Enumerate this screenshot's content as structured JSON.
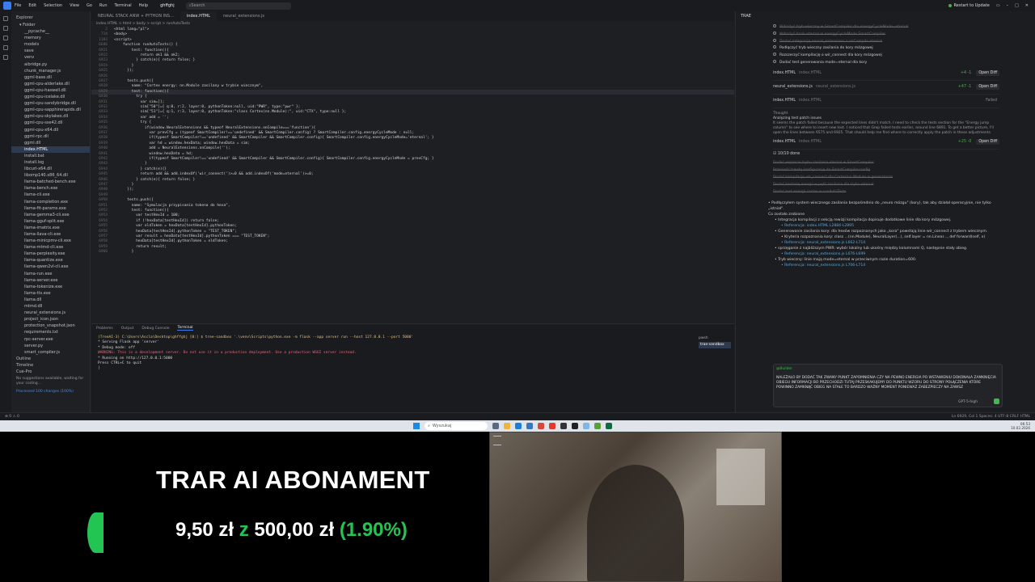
{
  "titlebar": {
    "menu": [
      "File",
      "Edit",
      "Selection",
      "View",
      "Go",
      "Run",
      "Terminal",
      "Help"
    ],
    "project": "ghffghj",
    "search_placeholder": "Search",
    "restart_label": "Restart to Update"
  },
  "explorer": {
    "header": "Explorer",
    "folder_label": "Folder",
    "items": [
      "__pycache__",
      "memory",
      "models",
      "save",
      "venv",
      "aibridge.py",
      "chunk_manager.js",
      "ggml-base.dll",
      "ggml-cpu-alderlake.dll",
      "ggml-cpu-haswell.dll",
      "ggml-cpu-icelake.dll",
      "ggml-cpu-sandybridge.dll",
      "ggml-cpu-sapphirerapids.dll",
      "ggml-cpu-skylakex.dll",
      "ggml-cpu-sse42.dll",
      "ggml-cpu-x64.dll",
      "ggml-rpc.dll",
      "ggml.dll",
      "index.HTML",
      "install.bat",
      "install.log",
      "libcurl-x64.dll",
      "libomp140.x86_64.dll",
      "llama-batched-bench.exe",
      "llama-bench.exe",
      "llama-cli.exe",
      "llama-completion.exe",
      "llama-fit-params.exe",
      "llama-gemma3-cli.exe",
      "llama-gguf-split.exe",
      "llama-imatrix.exe",
      "llama-llava-cli.exe",
      "llama-minicpmv-cli.exe",
      "llama-mtmd-cli.exe",
      "llama-perplexity.exe",
      "llama-quantize.exe",
      "llama-qwen2vl-cli.exe",
      "llama-run.exe",
      "llama-server.exe",
      "llama-tokenize.exe",
      "llama-tts.exe",
      "llama.dll",
      "mtmd.dll",
      "neural_extensions.js",
      "project_icon.json",
      "protection_snapshot.json",
      "requirements.txt",
      "rpc-server.exe",
      "server.py",
      "smart_compiler.js"
    ],
    "selected": "index.HTML",
    "sections": [
      "Outline",
      "Timeline",
      "Cue-Pro"
    ],
    "note": "No suggestions available, waiting for your coding...",
    "processed": "Processed 100 changes (100%)"
  },
  "editor": {
    "tabs": [
      "NEURAL STACK ANW + PYTHON INS...",
      "index.HTML",
      "neural_extensions.js"
    ],
    "active_tab": "index.HTML",
    "breadcrumb": "index.HTML > html > body > script > runAutoTests",
    "lines": [
      {
        "n": "2",
        "t": "<html lang=\"pl\">"
      },
      {
        "n": "714",
        "t": "<body>"
      },
      {
        "n": "1183",
        "t": "<script>"
      },
      {
        "n": "6686",
        "t": "    function runAutoTests() {"
      },
      {
        "n": "6921",
        "t": "        test: function(){"
      },
      {
        "n": "6922",
        "t": "            return ok1 && ok2;"
      },
      {
        "n": "6923",
        "t": "          } catch(e){ return false; }"
      },
      {
        "n": "6924",
        "t": "        }"
      },
      {
        "n": "6925",
        "t": "      });"
      },
      {
        "n": "6926",
        "t": ""
      },
      {
        "n": "6927",
        "t": "      tests.push({"
      },
      {
        "n": "6928",
        "t": "        name: \"Cortex energy: nn.Module zasilany w trybie wiecznym\","
      },
      {
        "n": "6929",
        "t": "        test: function(){"
      },
      {
        "n": "6930",
        "t": "          try {"
      },
      {
        "n": "6931",
        "t": "            var sim=[];"
      },
      {
        "n": "6932",
        "t": "            sim[\"50\"]={ q:0, r:2, layer:0, pythonToken:null, uid:\"PWR\", type:\"pwr\" };"
      },
      {
        "n": "6933",
        "t": "            sim[\"51\"]={ q:1, r:3, layer:0, pythonToken:\"class Cortex(nn.Module):\", uid:\"CTX\", type:null };"
      },
      {
        "n": "6934",
        "t": "            var add = '';"
      },
      {
        "n": "6935",
        "t": "            try {"
      },
      {
        "n": "6936",
        "t": "              if(window.NeuralExtensions && typeof NeuralExtensions.onCompile==='function'){"
      },
      {
        "n": "6937",
        "t": "                var prevCfg = (typeof SmartCompiler!=='undefined' && SmartCompiler.config) ? SmartCompiler.config.energyCycleMode : null;"
      },
      {
        "n": "6938",
        "t": "                if(typeof SmartCompiler!=='undefined' && SmartCompiler && SmartCompiler.config){ SmartCompiler.config.energyCycleMode='eternal'; }"
      },
      {
        "n": "6939",
        "t": "                var hd = window.hexData; window.hexData = sim;"
      },
      {
        "n": "6940",
        "t": "                add = NeuralExtensions.onCompile('');"
      },
      {
        "n": "6941",
        "t": "                window.hexData = hd;"
      },
      {
        "n": "6942",
        "t": "                if(typeof SmartCompiler!=='undefined' && SmartCompiler && SmartCompiler.config){ SmartCompiler.config.energyCycleMode = prevCfg; }"
      },
      {
        "n": "6943",
        "t": "              }"
      },
      {
        "n": "6944",
        "t": "            } catch(e){}"
      },
      {
        "n": "6945",
        "t": "            return add && add.indexOf('wir_connect(')>=0 && add.indexOf('mode=eternal')>=0;"
      },
      {
        "n": "6946",
        "t": "          } catch(e){ return false; }"
      },
      {
        "n": "6947",
        "t": "        }"
      },
      {
        "n": "6948",
        "t": "      });"
      },
      {
        "n": "6949",
        "t": ""
      },
      {
        "n": "6950",
        "t": "      tests.push({"
      },
      {
        "n": "6951",
        "t": "        name: \"Symulacja przypisania tokena do hexa\","
      },
      {
        "n": "6952",
        "t": "        test: function(){"
      },
      {
        "n": "6953",
        "t": "          var testHexId = 100;"
      },
      {
        "n": "6954",
        "t": "          if (!hexData[testHexId]) return false;"
      },
      {
        "n": "6955",
        "t": "          var oldToken = hexData[testHexId].pythonToken;"
      },
      {
        "n": "6956",
        "t": "          hexData[testHexId].pythonToken = \"TEST_TOKEN\";"
      },
      {
        "n": "6957",
        "t": "          var result = hexData[testHexId].pythonToken === \"TEST_TOKEN\";"
      },
      {
        "n": "6958",
        "t": "          hexData[testHexId].pythonToken = oldToken;"
      },
      {
        "n": "6959",
        "t": "          return result;"
      },
      {
        "n": "6960",
        "t": "        }"
      }
    ]
  },
  "terminal": {
    "tabs": [
      "Problems",
      "Output",
      "Debug Console",
      "Terminal"
    ],
    "active_tab": "Terminal",
    "lines": [
      {
        "c": "y",
        "t": "(TreeAI-3) C:\\Users\\Ascla\\Desktop\\ghffghj [0:] $ tree-sandbox  '.\\venv\\Scripts\\python.exe -m flask --app server run --host 127.0.0.1 --port 5000'"
      },
      {
        "c": "w",
        "t": " * Serving Flask app 'server'"
      },
      {
        "c": "w",
        "t": " * Debug mode: off"
      },
      {
        "c": "r",
        "t": "WARNING: This is a development server. Do not use it in a production deployment. Use a production WSGI server instead."
      },
      {
        "c": "w",
        "t": " * Running on http://127.0.0.1:5000"
      },
      {
        "c": "w",
        "t": "Press CTRL+C to quit"
      },
      {
        "c": "w",
        "t": "|"
      }
    ],
    "side": [
      "pwsh",
      "trae-sandbox"
    ]
  },
  "panel": {
    "title": "TRAE",
    "todos": [
      {
        "t": "Wdrożyć tryb wieczny w SmartCompiler dla energyCycleMode=eternal",
        "d": true
      },
      {
        "t": "Wdrożyć hook eternal w energyCycleMode SmartCompiler",
        "d": true
      },
      {
        "t": "Dodać integrację neural_extensions z onCompile eternal",
        "d": true
      },
      {
        "t": "Podłączyć tryb wieczny zasilania do kory mózgowej",
        "d": false
      },
      {
        "t": "Rozszerzyć kompilację o wir_connect dla kory mózgowej",
        "d": false
      },
      {
        "t": "Dodać test generowania mode=eternal dla kory",
        "d": false
      }
    ],
    "files": [
      {
        "name": "index.HTML",
        "sub": "index.HTML",
        "stat": "+4 -1",
        "btn": "Open Diff"
      },
      {
        "name": "neural_extensions.js",
        "sub": "neural_extensions.js",
        "stat": "+47 -1",
        "btn": "Open Diff"
      },
      {
        "name": "index.HTML",
        "sub": "index.HTML",
        "stat": "",
        "btn": "Failed"
      }
    ],
    "thought_label": "Thought",
    "thought_title": "Analyzing test patch issues",
    "thought_text": "It seems the patch failed because the expected lines didn't match. I need to check the tests section for the \"Energy jump column\" to see where to insert new test. I noticed that Grep failed tests earlier, around line 6891. To get a better picture, I'll open the lines between 6575 and 6925. That should help me find where to correctly apply the patch in these adjustments.",
    "file4": {
      "name": "index.HTML",
      "sub": "index.HTML",
      "stat": "+25 -0",
      "btn": "Open Diff"
    },
    "progress": "10/10 done",
    "done_items": [
      "Dodać wsparcie trybu zasilania eternal w SmartCompiler",
      "Przenieść trwałą konfigurację do SmartCompiler.config",
      "Dodać kompilację wir_connect dla Cortex/nn.Module w generatorze",
      "Dodać kontrolę energii w pętli zasilania dla trybu eternal",
      "Dodać test energii cortex w runAutoTests"
    ],
    "summary": [
      {
        "cls": "",
        "t": "• Podłączyłem system wiecznego zasilania bezpośrednio do „neuro mózgu\" (kory), tak aby działał operacyjnie, nie tylko „istniał\"."
      },
      {
        "cls": "",
        "t": "Co zostało zrobione"
      },
      {
        "cls": "b",
        "t": "• Integracja kompilacji z sekcją rewizji kompilacja dopisuje dodatkowe linie dla kory mózgowej."
      },
      {
        "cls": "bb",
        "t": "• Referencja: index.HTML L2884-L2895"
      },
      {
        "cls": "b",
        "t": "• Generowanie zasilania kory: dla hexów rozpoznanych jako „kora\" powstają linie wir_connect z trybem wiecznym."
      },
      {
        "cls": "bb",
        "t": "• Kryteria rozpoznania kory: class ...(nn.Module), NeuralLayer(...), self.layer = nn.Linear..., def forward(self, x)"
      },
      {
        "cls": "bb",
        "t": "• Referencja: neural_extensions.js L662-L714"
      },
      {
        "cls": "b",
        "t": "• sprzęganie z najbliższym PWR: wybór lokalny lub ukośny między kolumnami Q, następnie stały obieg."
      },
      {
        "cls": "bb",
        "t": "• Referencja: neural_extensions.js L676-L699"
      },
      {
        "cls": "b",
        "t": "• Tryb wieczny: linie mają mode=eternal w przeciwnym razie duration=600."
      },
      {
        "cls": "bb",
        "t": "• Referencja: neural_extensions.js L706-L714"
      }
    ],
    "chat_tag": "@Builder",
    "chat_message": "NALEŻAŁO BY DODAĆ TAK ZWANY PUNKT ZAPOMNIENIA CZY NA PEWNO ENERGIA PO WSTAWIENIU DOKONAŁA ZAMKNIĘCIA OBIEGU INFORMACJI BO PRZECHODZI TUTAJ PRZESKAKUJEMY DO PUNKTU WZORU DO STRONY POŁĄCZENIA KTÓRE POWINNO ZAMKNĄĆ OBIEG NA STAŁE TO BARDZO WAŻNY MOMENT PONIEWAŻ ZABEZPIECZY NA ZAWSZ",
    "model": "GPT-5-high"
  },
  "statusbar": {
    "left": "⊗ 0  ⚠ 0",
    "right": "Ln 6929, Col 1   Spaces: 4   UTF-8   CRLF   HTML"
  },
  "taskbar": {
    "search_placeholder": "Wyszukaj",
    "time": "06:53",
    "date": "10.02.2026"
  },
  "overlay": {
    "title": "TRAR AI ABONAMENT",
    "amount": "9,50 zł",
    "z": "z",
    "goal": "500,00 zł",
    "percent": "(1.90%)",
    "progress_fraction": 0.019,
    "accent": "#23c552"
  }
}
